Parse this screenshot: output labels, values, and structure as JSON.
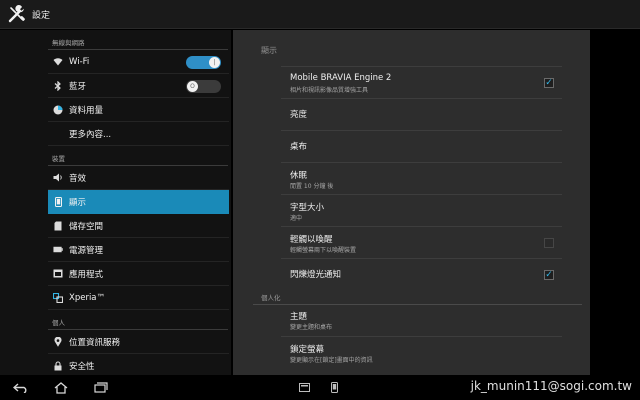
{
  "actionbar": {
    "title": "設定"
  },
  "sidebar": {
    "sections": [
      {
        "header": "無線與網路"
      },
      {
        "header": "裝置"
      },
      {
        "header": "個人"
      }
    ],
    "items": [
      {
        "label": "Wi-Fi"
      },
      {
        "label": "藍牙"
      },
      {
        "label": "資料用量"
      },
      {
        "label": "更多內容..."
      },
      {
        "label": "音效"
      },
      {
        "label": "顯示"
      },
      {
        "label": "儲存空間"
      },
      {
        "label": "電源管理"
      },
      {
        "label": "應用程式"
      },
      {
        "label": "Xperia™"
      },
      {
        "label": "位置資訊服務"
      },
      {
        "label": "安全性"
      }
    ],
    "wifi_toggle": "on",
    "bt_toggle": "off"
  },
  "panel": {
    "header": "顯示",
    "prefs": [
      {
        "title": "Mobile BRAVIA Engine 2",
        "summary": "相片和視訊影像品質增強工具",
        "checked": true
      },
      {
        "title": "亮度"
      },
      {
        "title": "桌布"
      },
      {
        "title": "休眠",
        "summary": "閒置 10 分鐘 後"
      },
      {
        "title": "字型大小",
        "summary": "適中"
      },
      {
        "title": "輕觸以喚醒",
        "summary": "輕觸螢幕兩下以喚醒裝置",
        "checked": false
      },
      {
        "title": "閃爍燈光通知",
        "checked": true
      }
    ],
    "category": "個人化",
    "prefs2": [
      {
        "title": "主題",
        "summary": "變更主題和桌布"
      },
      {
        "title": "鎖定螢幕",
        "summary": "變更顯示在[鎖定]畫面中的資訊"
      }
    ]
  },
  "watermark": "jk_munin111@sogi.com.tw",
  "colors": {
    "accent": "#1a8ab8",
    "check": "#33b5e5",
    "panel": "#2d2d2d"
  }
}
